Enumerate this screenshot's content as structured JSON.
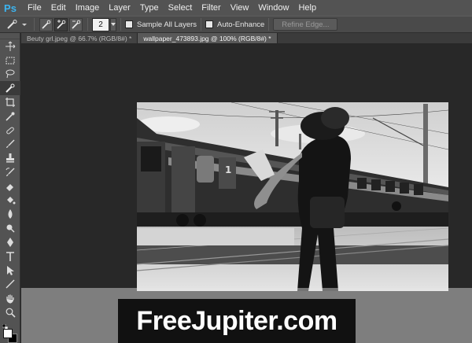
{
  "app": {
    "logo_text": "Ps"
  },
  "menus": [
    "File",
    "Edit",
    "Image",
    "Layer",
    "Type",
    "Select",
    "Filter",
    "View",
    "Window",
    "Help"
  ],
  "options_bar": {
    "brush_size": "2",
    "sample_all_layers": "Sample All Layers",
    "auto_enhance": "Auto-Enhance",
    "refine_edge": "Refine Edge..."
  },
  "tabs": [
    {
      "label": "Beuty grl.jpeg @ 66.7% (RGB/8#) *",
      "active": false
    },
    {
      "label": "wallpaper_473893.jpg @ 100% (RGB/8#) *",
      "active": true
    }
  ],
  "tools": [
    "move-tool",
    "marquee-tool",
    "lasso-tool",
    "quick-selection-tool",
    "crop-tool",
    "eyedropper-tool",
    "spot-healing-tool",
    "brush-tool",
    "clone-stamp-tool",
    "history-brush-tool",
    "eraser-tool",
    "paint-bucket-tool",
    "blur-tool",
    "dodge-tool",
    "pen-tool",
    "type-tool",
    "path-selection-tool",
    "line-tool",
    "hand-tool",
    "zoom-tool"
  ],
  "colors": {
    "foreground": "#ffffff",
    "background": "#000000",
    "accent": "#3cb4f0"
  },
  "watermark": {
    "text": "FreeJupiter.com"
  }
}
